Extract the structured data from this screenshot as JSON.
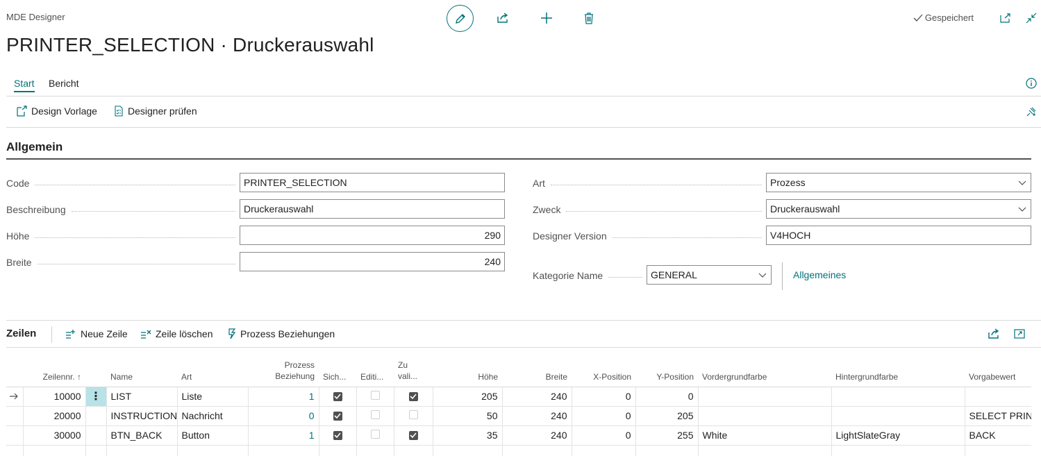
{
  "header": {
    "app_title": "MDE Designer",
    "page_title": "PRINTER_SELECTION · Druckerauswahl",
    "status": "Gespeichert",
    "icons": [
      "edit-icon",
      "share-icon",
      "add-icon",
      "delete-icon",
      "open-new-window-icon",
      "collapse-icon"
    ]
  },
  "tabs": [
    {
      "label": "Start",
      "active": true
    },
    {
      "label": "Bericht",
      "active": false
    }
  ],
  "actions": {
    "design_template": "Design Vorlage",
    "check_designer": "Designer prüfen"
  },
  "general": {
    "title": "Allgemein",
    "fields": {
      "code": {
        "label": "Code",
        "value": "PRINTER_SELECTION"
      },
      "beschreibung": {
        "label": "Beschreibung",
        "value": "Druckerauswahl"
      },
      "hoehe": {
        "label": "Höhe",
        "value": "290"
      },
      "breite": {
        "label": "Breite",
        "value": "240"
      },
      "art": {
        "label": "Art",
        "value": "Prozess"
      },
      "zweck": {
        "label": "Zweck",
        "value": "Druckerauswahl"
      },
      "designer_version": {
        "label": "Designer Version",
        "value": "V4HOCH"
      },
      "kategorie_name": {
        "label": "Kategorie Name",
        "value": "GENERAL",
        "link": "Allgemeines"
      }
    }
  },
  "lines": {
    "title": "Zeilen",
    "actions": {
      "new_line": "Neue Zeile",
      "delete_line": "Zeile löschen",
      "process_relations": "Prozess Beziehungen"
    },
    "columns": {
      "zeilennr": "Zeilennr. ↑",
      "name": "Name",
      "art": "Art",
      "prozess_beziehung_1": "Prozess",
      "prozess_beziehung_2": "Beziehung",
      "sich": "Sich...",
      "editi": "Editi...",
      "zu_1": "Zu",
      "zu_2": "vali...",
      "hoehe": "Höhe",
      "breite": "Breite",
      "x_position": "X-Position",
      "y_position": "Y-Position",
      "vordergrundfarbe": "Vordergrundfarbe",
      "hintergrundfarbe": "Hintergrundfarbe",
      "vorgabewert": "Vorgabewert"
    },
    "rows": [
      {
        "zeilennr": "10000",
        "name": "LIST",
        "art": "Liste",
        "prozess": "1",
        "sich": true,
        "editi": false,
        "zu": true,
        "hoehe": "205",
        "breite": "240",
        "x": "0",
        "y": "0",
        "vorder": "",
        "hinter": "",
        "vorgabe": "",
        "selected": true
      },
      {
        "zeilennr": "20000",
        "name": "INSTRUCTION",
        "art": "Nachricht",
        "prozess": "0",
        "sich": true,
        "editi": false,
        "zu": false,
        "hoehe": "50",
        "breite": "240",
        "x": "0",
        "y": "205",
        "vorder": "",
        "hinter": "",
        "vorgabe": "SELECT PRINTE",
        "selected": false
      },
      {
        "zeilennr": "30000",
        "name": "BTN_BACK",
        "art": "Button",
        "prozess": "1",
        "sich": true,
        "editi": false,
        "zu": true,
        "hoehe": "35",
        "breite": "240",
        "x": "0",
        "y": "255",
        "vorder": "White",
        "hinter": "LightSlateGray",
        "vorgabe": "BACK",
        "selected": false
      }
    ]
  },
  "colors": {
    "accent": "#00727a",
    "text": "#212121",
    "muted": "#505050",
    "row_marker": "#b7e3e8"
  }
}
